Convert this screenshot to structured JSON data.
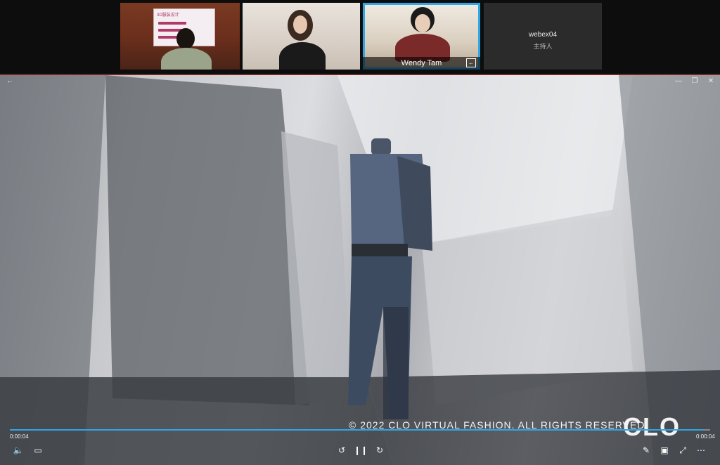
{
  "participants": [
    {
      "board_tag": "3D服装设计"
    },
    {},
    {
      "name": "Wendy Tam"
    },
    {
      "name": "webex04",
      "role": "主持人"
    }
  ],
  "video": {
    "watermark": "© 2022 CLO VIRTUAL FASHION. ALL RIGHTS RESERVED.",
    "logo": "CLO",
    "time_elapsed": "0:00:04",
    "time_total": "0:00:04",
    "progress": 0.99
  },
  "icons": {
    "back": "←",
    "minimize": "—",
    "restore": "❐",
    "close": "✕",
    "volume": "🔈",
    "captions": "▭",
    "rewind": "↺",
    "pause": "❙❙",
    "forward": "↻",
    "pen": "✎",
    "pip": "▣",
    "fullscreen": "⤢",
    "more": "⋯"
  }
}
